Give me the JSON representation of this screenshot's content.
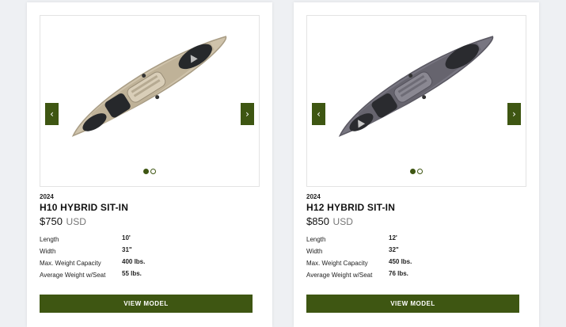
{
  "products": [
    {
      "year": "2024",
      "name": "H10 HYBRID SIT-IN",
      "price": "$750",
      "currency": "USD",
      "image": {
        "icon": "kayak-image",
        "hull_color": "#cfc3ab",
        "gallery_dots": 2,
        "active_dot": 1
      },
      "specs": [
        {
          "label": "Length",
          "value": "10'"
        },
        {
          "label": "Width",
          "value": "31\""
        },
        {
          "label": "Max. Weight Capacity",
          "value": "400 lbs."
        },
        {
          "label": "Average Weight w/Seat",
          "value": "55 lbs."
        }
      ],
      "cta": "VIEW MODEL"
    },
    {
      "year": "2024",
      "name": "H12 HYBRID SIT-IN",
      "price": "$850",
      "currency": "USD",
      "image": {
        "icon": "kayak-image",
        "hull_color": "#777580",
        "gallery_dots": 2,
        "active_dot": 1
      },
      "specs": [
        {
          "label": "Length",
          "value": "12'"
        },
        {
          "label": "Width",
          "value": "32\""
        },
        {
          "label": "Max. Weight Capacity",
          "value": "450 lbs."
        },
        {
          "label": "Average Weight w/Seat",
          "value": "76 lbs."
        }
      ],
      "cta": "VIEW MODEL"
    }
  ],
  "carousel": {
    "prev_icon": "chevron-left-icon",
    "next_icon": "chevron-right-icon"
  },
  "colors": {
    "accent": "#3e5612",
    "page_background": "#eef0f3"
  }
}
